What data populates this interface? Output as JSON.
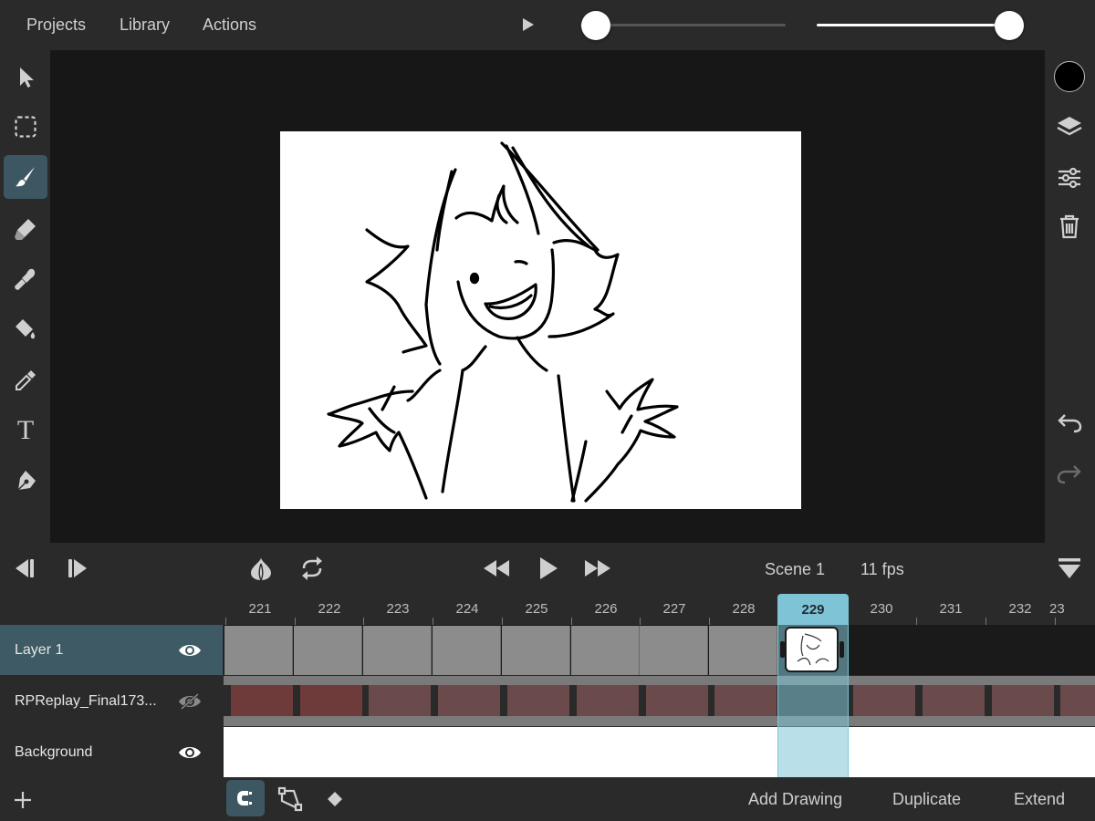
{
  "menu": {
    "projects": "Projects",
    "library": "Library",
    "actions": "Actions"
  },
  "sliders": {
    "brush_size_fraction": 0.09,
    "opacity_fraction": 0.93
  },
  "left_tools": [
    {
      "name": "select-tool",
      "icon": "arrow-cursor-icon"
    },
    {
      "name": "marquee-tool",
      "icon": "dashed-square-icon"
    },
    {
      "name": "brush-tool",
      "icon": "brush-icon",
      "active": true
    },
    {
      "name": "eraser-tool",
      "icon": "eraser-icon"
    },
    {
      "name": "smudge-tool",
      "icon": "smudge-icon"
    },
    {
      "name": "fill-tool",
      "icon": "paint-bucket-icon"
    },
    {
      "name": "eyedropper-tool",
      "icon": "eyedropper-icon"
    },
    {
      "name": "text-tool",
      "icon": "text-icon",
      "glyph": "T"
    },
    {
      "name": "pen-tool",
      "icon": "pen-nib-icon"
    }
  ],
  "right_tools": {
    "color": "#000000",
    "items": [
      "layers-icon",
      "adjustments-icon",
      "trash-icon",
      "undo-icon",
      "redo-icon"
    ]
  },
  "transport": {
    "scene": "Scene 1",
    "fps": "11 fps"
  },
  "timeline": {
    "frames": [
      "221",
      "222",
      "223",
      "224",
      "225",
      "226",
      "227",
      "228",
      "229",
      "230",
      "231",
      "232",
      "23"
    ],
    "current_frame": "229",
    "layers": [
      {
        "name": "Layer 1",
        "visible": true,
        "selected": true
      },
      {
        "name": "RPReplay_Final173...",
        "visible": false,
        "selected": false
      },
      {
        "name": "Background",
        "visible": true,
        "selected": false
      }
    ]
  },
  "bottom": {
    "add_drawing": "Add Drawing",
    "duplicate": "Duplicate",
    "extend": "Extend"
  },
  "colors": {
    "accent": "#3d5762",
    "playhead": "#7fc4d6",
    "stage": "#171717"
  }
}
